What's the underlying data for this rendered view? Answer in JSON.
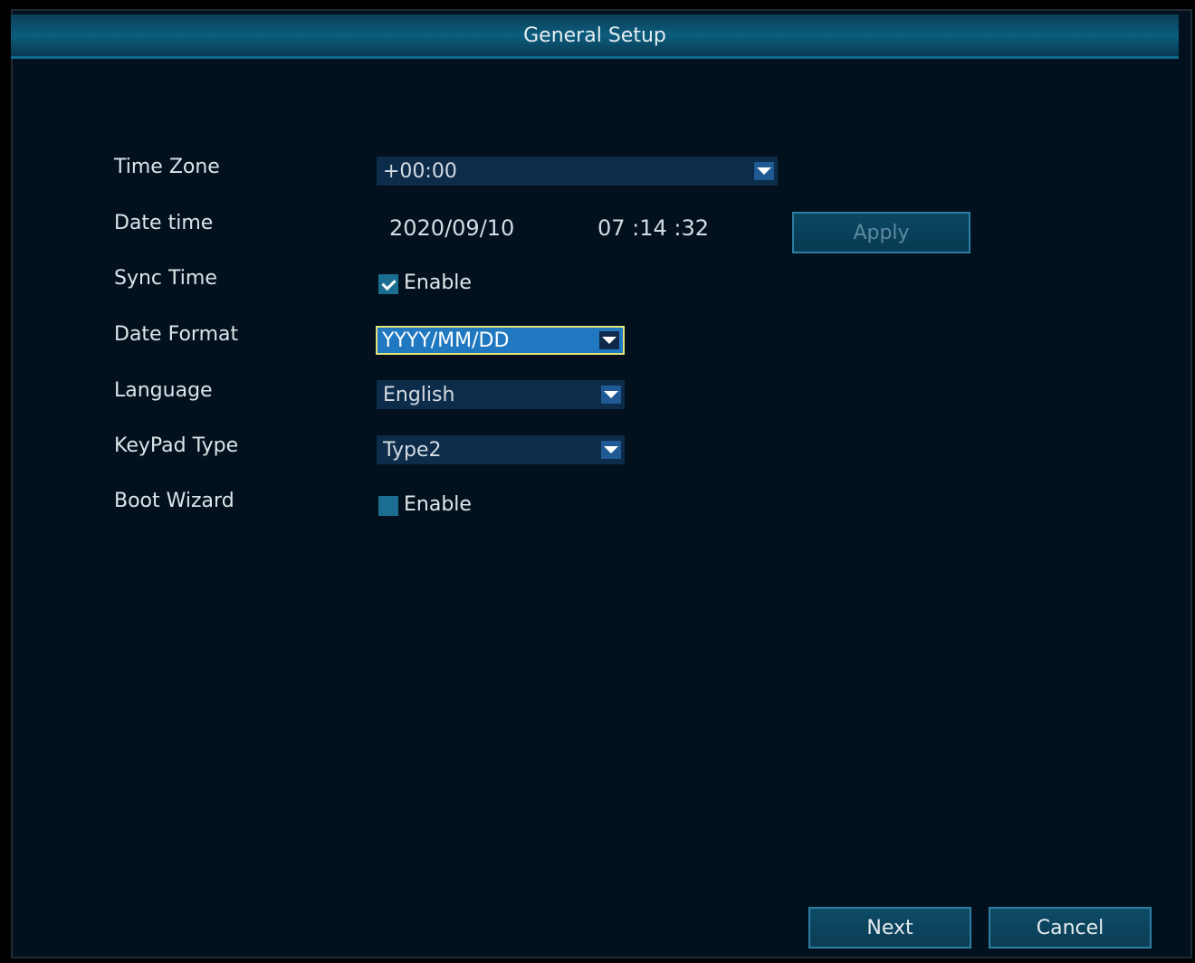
{
  "window": {
    "title": "General Setup"
  },
  "fields": {
    "time_zone": {
      "label": "Time Zone",
      "value": "+00:00"
    },
    "date_time": {
      "label": "Date time",
      "date": "2020/09/10",
      "time": "07 :14 :32",
      "apply_label": "Apply"
    },
    "sync_time": {
      "label": "Sync Time",
      "checkbox_label": "Enable",
      "checked": true
    },
    "date_format": {
      "label": "Date Format",
      "value": "YYYY/MM/DD"
    },
    "language": {
      "label": "Language",
      "value": "English"
    },
    "keypad_type": {
      "label": "KeyPad Type",
      "value": "Type2"
    },
    "boot_wizard": {
      "label": "Boot Wizard",
      "checkbox_label": "Enable",
      "checked": false
    }
  },
  "footer": {
    "next_label": "Next",
    "cancel_label": "Cancel"
  },
  "colors": {
    "background": "#03111e",
    "title_bar": "#0b5d7d",
    "dropdown_bg": "#0d2c4a",
    "focused_dropdown_bg": "#1f78c0",
    "focus_border": "#e2e47a",
    "checkbox_bg": "#1b6e91"
  },
  "icons": {
    "dropdown_arrow": "chevron-down-icon",
    "checkmark": "checkmark-icon"
  }
}
